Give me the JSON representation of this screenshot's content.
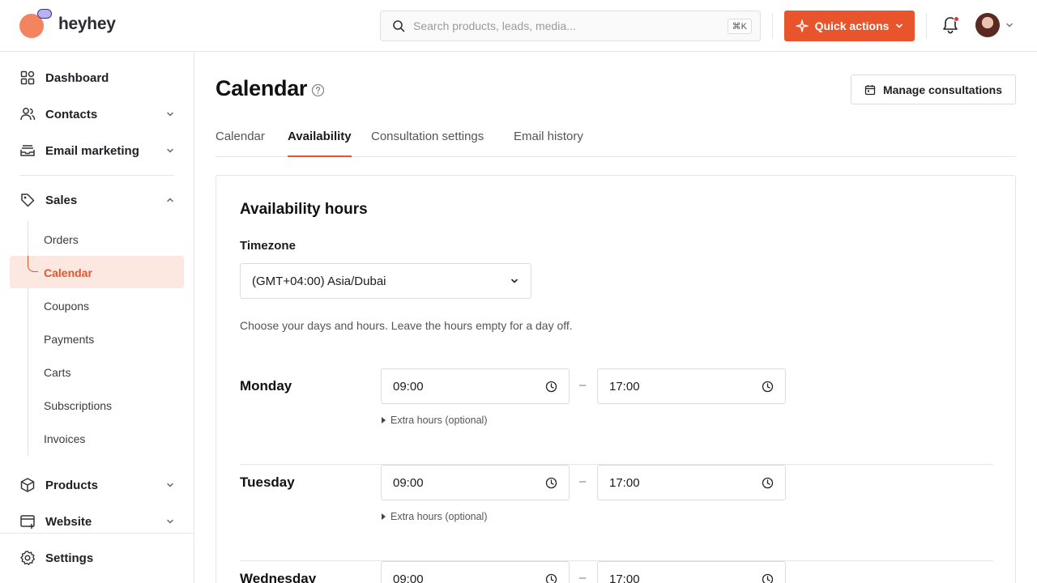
{
  "header": {
    "brand": "heyhey",
    "search_placeholder": "Search products, leads, media...",
    "search_shortcut": "⌘K",
    "quick_actions_label": "Quick actions"
  },
  "sidebar": {
    "items": [
      {
        "label": "Dashboard",
        "icon": "grid-icon"
      },
      {
        "label": "Contacts",
        "icon": "users-icon"
      },
      {
        "label": "Email marketing",
        "icon": "inbox-icon"
      },
      {
        "label": "Sales",
        "icon": "tag-icon"
      },
      {
        "label": "Products",
        "icon": "box-icon"
      },
      {
        "label": "Website",
        "icon": "browser-icon"
      },
      {
        "label": "Settings",
        "icon": "gear-icon"
      }
    ],
    "sales_sub": [
      "Orders",
      "Calendar",
      "Coupons",
      "Payments",
      "Carts",
      "Subscriptions",
      "Invoices"
    ],
    "active_sub": "Calendar"
  },
  "page": {
    "title": "Calendar",
    "manage_label": "Manage consultations",
    "tabs": [
      "Calendar",
      "Availability",
      "Consultation settings",
      "Email history"
    ],
    "active_tab": "Availability"
  },
  "availability": {
    "title": "Availability hours",
    "timezone_label": "Timezone",
    "timezone_value": "(GMT+04:00) Asia/Dubai",
    "hint": "Choose your days and hours. Leave the hours empty for a day off.",
    "separator": "–",
    "extra_label": "Extra hours (optional)",
    "days": [
      {
        "name": "Monday",
        "start": "09:00",
        "end": "17:00"
      },
      {
        "name": "Tuesday",
        "start": "09:00",
        "end": "17:00"
      },
      {
        "name": "Wednesday",
        "start": "09:00",
        "end": "17:00"
      }
    ]
  },
  "colors": {
    "accent": "#e8542b",
    "active_bg": "#fde8e1",
    "border": "#e6e6e6"
  }
}
